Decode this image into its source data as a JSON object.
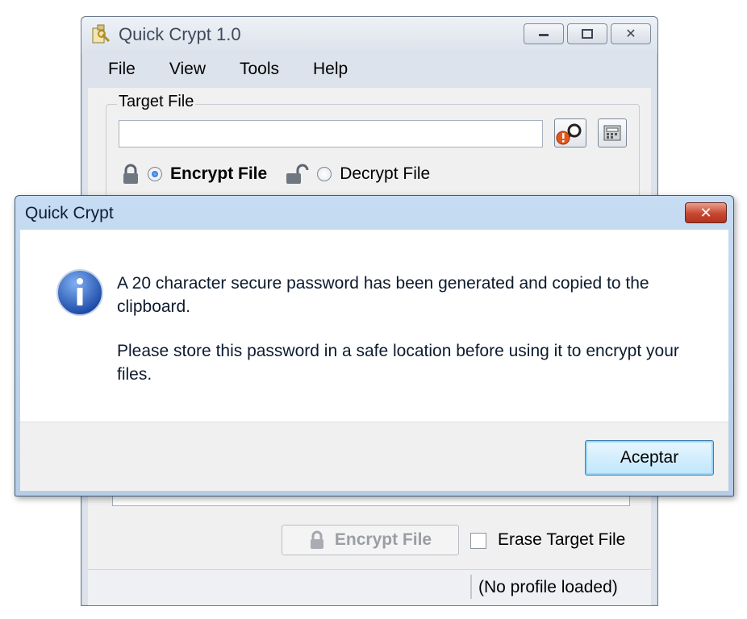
{
  "main_window": {
    "title": "Quick Crypt 1.0",
    "controls": {
      "minimize": "—",
      "maximize": "▢",
      "close": "✕"
    },
    "menu": [
      "File",
      "View",
      "Tools",
      "Help"
    ],
    "target_group_label": "Target File",
    "target_input_value": "",
    "modes": {
      "encrypt_label": "Encrypt File",
      "decrypt_label": "Decrypt File",
      "selected": "encrypt"
    },
    "encrypt_button_label": "Encrypt File",
    "erase_label": "Erase Target File",
    "erase_checked": false,
    "status_text": "(No profile loaded)"
  },
  "dialog": {
    "title": "Quick Crypt",
    "close_glyph": "✕",
    "message_1": "A 20 character secure password has been generated and copied to the clipboard.",
    "message_2": "Please store this password in a safe location before using it to encrypt your files.",
    "ok_label": "Aceptar",
    "icon": "info-icon"
  },
  "colors": {
    "dialog_title_bg": "#c6dcf2",
    "close_button": "#c8462f",
    "info_icon": "#1f55b8",
    "ok_button_border": "#3c7fb1"
  }
}
